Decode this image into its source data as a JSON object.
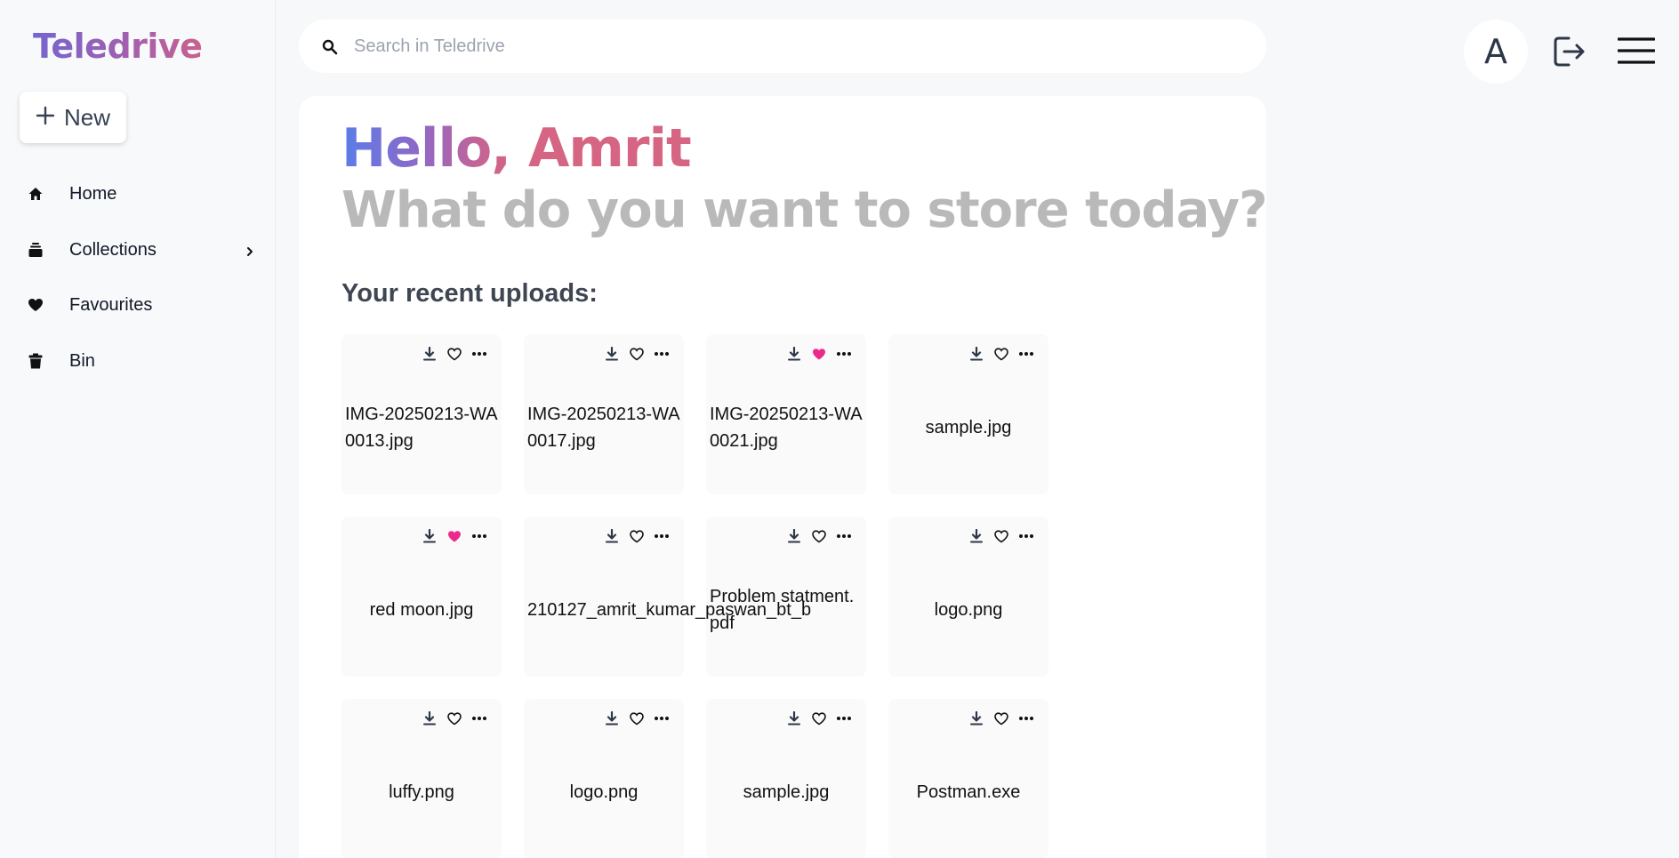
{
  "app": {
    "brand": "Teledrive"
  },
  "sidebar": {
    "new_label": "New",
    "items": [
      {
        "label": "Home",
        "icon": "home-icon"
      },
      {
        "label": "Collections",
        "icon": "collections-icon",
        "has_submenu": true
      },
      {
        "label": "Favourites",
        "icon": "heart-icon"
      },
      {
        "label": "Bin",
        "icon": "trash-icon"
      }
    ]
  },
  "search": {
    "placeholder": "Search in Teledrive",
    "value": ""
  },
  "user": {
    "avatar_initial": "A"
  },
  "main": {
    "greeting": "Hello, Amrit",
    "subtitle": "What do you want to store today?",
    "recent_title": "Your recent uploads:"
  },
  "files": [
    {
      "name": "IMG-20250213-WA0013.jpg",
      "favourite": false
    },
    {
      "name": "IMG-20250213-WA0017.jpg",
      "favourite": false
    },
    {
      "name": "IMG-20250213-WA0021.jpg",
      "favourite": true
    },
    {
      "name": "sample.jpg",
      "favourite": false
    },
    {
      "name": "red moon.jpg",
      "favourite": true
    },
    {
      "name": "210127_amrit_kumar_paswan_bt_b",
      "favourite": false
    },
    {
      "name": "Problem statment.pdf",
      "favourite": false
    },
    {
      "name": "logo.png",
      "favourite": false
    },
    {
      "name": "luffy.png",
      "favourite": false
    },
    {
      "name": "logo.png",
      "favourite": false
    },
    {
      "name": "sample.jpg",
      "favourite": false
    },
    {
      "name": "Postman.exe",
      "favourite": false
    }
  ],
  "colors": {
    "favourite": "#ec2a8c",
    "brand_start": "#7565cf",
    "brand_end": "#c9618e"
  }
}
